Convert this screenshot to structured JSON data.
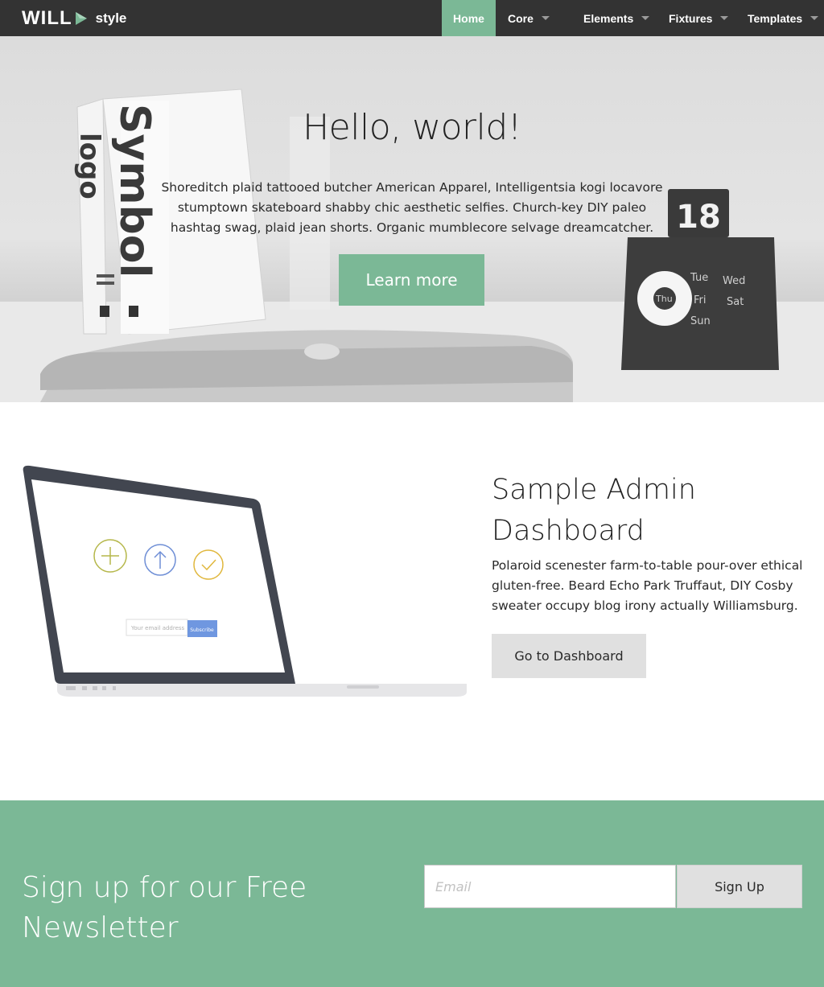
{
  "navbar": {
    "logo_text": "WILL",
    "logo_suffix": "style",
    "items": [
      {
        "label": "Home",
        "active": true
      },
      {
        "label": "Core",
        "dropdown": true
      },
      {
        "label": "Elements",
        "dropdown": true
      },
      {
        "label": "Fixtures",
        "dropdown": true
      },
      {
        "label": "Templates",
        "dropdown": true
      }
    ]
  },
  "hero": {
    "title": "Hello, world!",
    "text": "Shoreditch plaid tattooed butcher American Apparel, Intelligentsia kogi locavore stumptown skateboard shabby chic aesthetic selfies. Church-key DIY paleo hashtag swag, plaid jean shorts. Organic mumblecore selvage dreamcatcher.",
    "button": "Learn more",
    "photo": {
      "book_spine": "Symbol",
      "book_spine_2": "logo",
      "calendar_number": "18",
      "calendar_days": [
        "Tue",
        "Wed",
        "Thu",
        "Fri",
        "Sat",
        "Sun"
      ]
    }
  },
  "feature": {
    "title_line1": "Sample Admin",
    "title_line2": "Dashboard",
    "text": "Polaroid scenester farm-to-table pour-over ethical gluten-free. Beard Echo Park Truffaut, DIY Cosby sweater occupy blog irony actually Williamsburg.",
    "button": "Go to Dashboard",
    "laptop_screen": {
      "email_placeholder": "Your email address",
      "subscribe": "Subscribe"
    }
  },
  "newsletter": {
    "title_line1": "Sign up for our Free",
    "title_line2": "Newsletter",
    "email_placeholder": "Email",
    "button": "Sign Up"
  },
  "colors": {
    "accent": "#7bb896",
    "navbar": "#333333",
    "button_gray": "#e0e0e0"
  }
}
